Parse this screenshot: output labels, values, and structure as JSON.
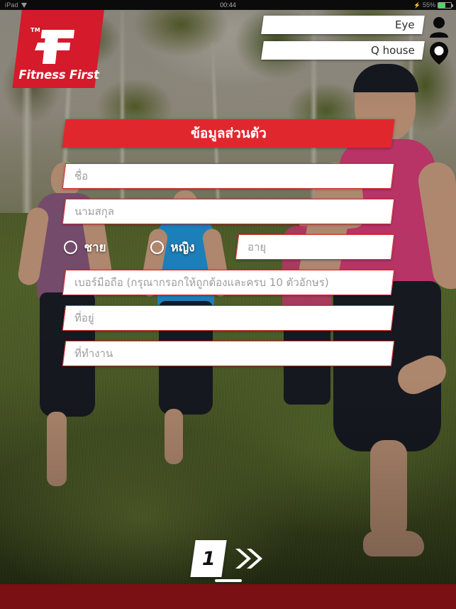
{
  "statusbar": {
    "device": "iPad",
    "wifi_icon": "wifi-icon",
    "time": "00:44",
    "charging_icon": "lightning-bolt-icon",
    "battery_percent": "55%",
    "battery_icon": "battery-icon"
  },
  "brand": {
    "logo_trademark": "TM",
    "logo_mark": "fitness-first-f-mark",
    "logo_wordmark": "Fitness First",
    "brand_red": "#d51a2b"
  },
  "topbar": {
    "fields": [
      {
        "name": "club-name-field",
        "value": "Eye",
        "icon": "person-icon"
      },
      {
        "name": "location-field",
        "value": "Q house",
        "icon": "location-pin-icon"
      }
    ],
    "person_icon": "person-icon",
    "pin_icon": "location-pin-icon"
  },
  "form": {
    "title": "ข้อมูลส่วนตัว",
    "title_color": "#e1272e",
    "fields": {
      "first_name_placeholder": "ชื่อ",
      "last_name_placeholder": "นามสกุล",
      "age_placeholder": "อายุ",
      "mobile_placeholder": "เบอร์มือถือ (กรุณากรอกให้ถูกต้องและครบ 10 ตัวอักษร)",
      "address_placeholder": "ที่อยู่",
      "workplace_placeholder": "ที่ทำงาน"
    },
    "values": {
      "first_name": "",
      "last_name": "",
      "age": "",
      "mobile": "",
      "address": "",
      "workplace": ""
    },
    "gender": {
      "male_label": "ชาย",
      "female_label": "หญิง",
      "selected": ""
    }
  },
  "footer": {
    "page_number": "1",
    "next_icon": "double-chevron-right-icon",
    "bar_color": "#7a1014"
  }
}
